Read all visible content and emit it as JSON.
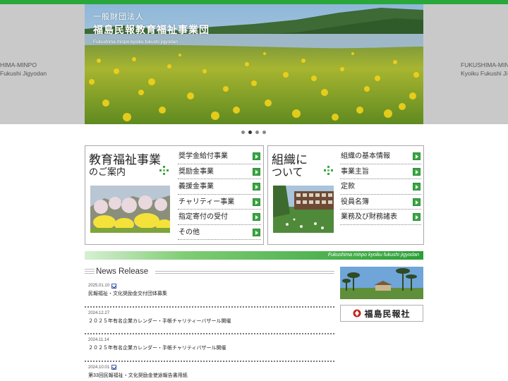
{
  "hero": {
    "org_type": "一般財団法人",
    "org_name": "福島民報教育福祉事業団",
    "org_name_en": "Fukushima minpo kyoiku fukushi jigyodan",
    "left_peek": [
      "HIMA-MINPO",
      "Fukushi Jigyodan"
    ],
    "right_peek": [
      "FUKUSHIMA-MINPO",
      "Kyoiku Fukushi Ji"
    ],
    "slides": 4,
    "active_slide": 2
  },
  "box_education": {
    "title_line1": "教育福祉事業",
    "title_line2": "のご案内",
    "photo_icon": "spring-blossom-photo",
    "items": [
      "奨学金給付事業",
      "奨励金事業",
      "義援金事業",
      "チャリティー事業",
      "指定寄付の受付",
      "その他"
    ]
  },
  "box_organization": {
    "title_line1": "組織に",
    "title_line2": "ついて",
    "photo_icon": "building-photo",
    "items": [
      "組織の基本情報",
      "事業主旨",
      "定款",
      "役員名簿",
      "業務及び財務諸表"
    ]
  },
  "banner": {
    "text": "Fukushima minpo kyoiku fukushi jigyodan"
  },
  "news": {
    "heading": "News Release",
    "items": [
      {
        "date": "2025.01.10",
        "title": "民報福祉・文化奨励金交付団体募集"
      },
      {
        "date": "2024.12.27",
        "title": "２０２５年有名企業カレンダー・手帳チャリティーバザール開催"
      },
      {
        "date": "2024.11.14",
        "title": "２０２５年有名企業カレンダー・手帳チャリティバザール開催"
      },
      {
        "date": "2024.10.01",
        "title": "第33回民報福祉・文化奨励金使途報告書用紙"
      }
    ]
  },
  "sidebar": {
    "photo_icon": "pine-trees-photo",
    "logo_text": "福島民報社"
  },
  "colors": {
    "accent_green": "#2aa73a",
    "arrow_green": "#3aa645"
  }
}
